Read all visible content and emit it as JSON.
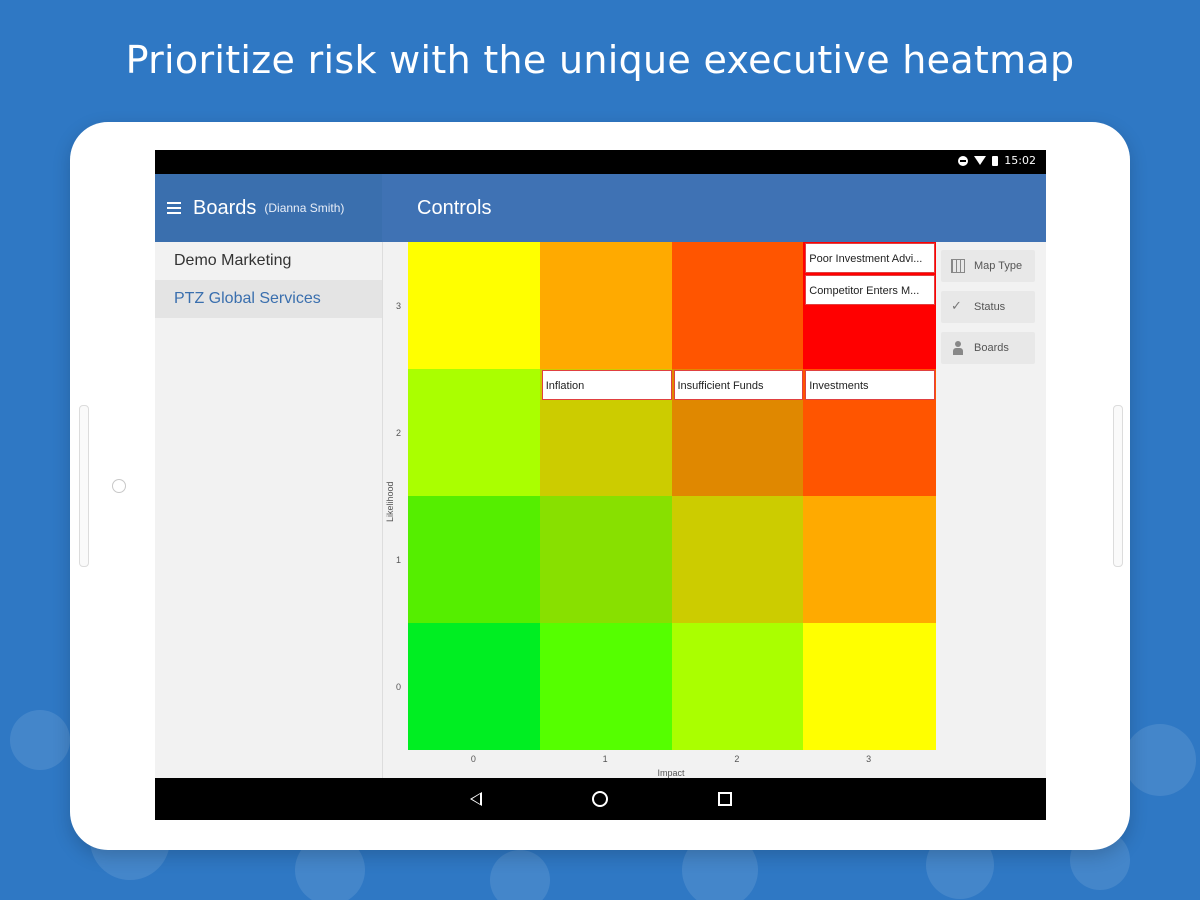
{
  "headline": "Prioritize risk with the unique executive heatmap",
  "status_bar": {
    "time": "15:02"
  },
  "app_bar": {
    "title": "Boards",
    "user": "(Dianna Smith)",
    "section_title": "Controls"
  },
  "boards": [
    {
      "label": "Demo Marketing",
      "active": false
    },
    {
      "label": "PTZ Global Services",
      "active": true
    }
  ],
  "heatmap": {
    "x_axis_label": "Impact",
    "y_axis_label": "Likelihood",
    "x_ticks": [
      "0",
      "1",
      "2",
      "3"
    ],
    "y_ticks": [
      "3",
      "2",
      "1",
      "0"
    ],
    "cell_colors": [
      [
        "#ffff00",
        "#ffaa00",
        "#ff5500",
        "#ff0000"
      ],
      [
        "#aaff00",
        "#cccc00",
        "#e08800",
        "#ff5500"
      ],
      [
        "#55ee00",
        "#88e000",
        "#cccc00",
        "#ffaa00"
      ],
      [
        "#00ee22",
        "#55ff00",
        "#aaff00",
        "#ffff00"
      ]
    ],
    "risks": [
      {
        "label": "Poor Investment Advi...",
        "likelihood": 3,
        "impact": 3
      },
      {
        "label": "Competitor Enters M...",
        "likelihood": 3,
        "impact": 3
      },
      {
        "label": "Inflation",
        "likelihood": 2,
        "impact": 1
      },
      {
        "label": "Insufficient Funds",
        "likelihood": 2,
        "impact": 2
      },
      {
        "label": "Investments",
        "likelihood": 2,
        "impact": 3
      }
    ]
  },
  "actions": [
    {
      "label": "Map Type",
      "icon": "map-type-icon"
    },
    {
      "label": "Status",
      "icon": "check-icon"
    },
    {
      "label": "Boards",
      "icon": "person-icon"
    }
  ],
  "colors": {
    "background": "#2f78c4",
    "appbar": "#3a6fae",
    "active_board": "#3a6fae"
  }
}
